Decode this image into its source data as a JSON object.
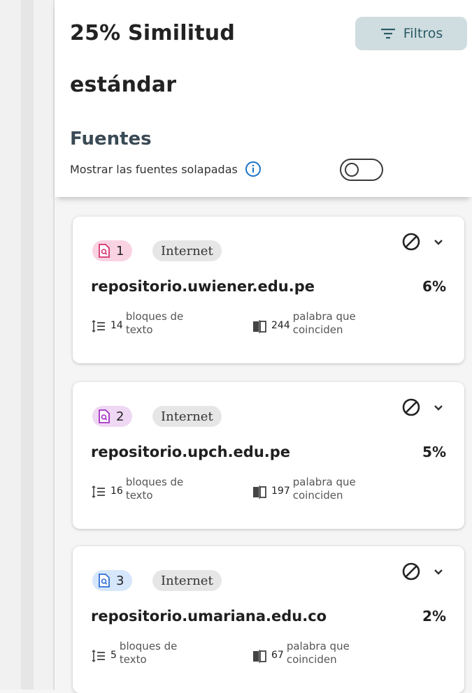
{
  "header": {
    "title_line1": "25% Similitud",
    "title_line2": "estándar",
    "filter_button_label": "Filtros",
    "sources_title": "Fuentes",
    "overlap_label": "Mostrar las fuentes solapadas"
  },
  "icons": {
    "filter": "filter-icon",
    "info": "info-icon",
    "toggle": "toggle-switch",
    "exclude": "ban-icon",
    "expand": "chevron-down-icon",
    "blocks": "text-blocks-icon",
    "words": "matching-words-icon",
    "source_doc": "document-search-icon"
  },
  "colors": {
    "filter_bg": "#cfdde0",
    "filter_text": "#2b5a66"
  },
  "sources": [
    {
      "rank": "1",
      "type": "Internet",
      "name": "repositorio.uwiener.edu.pe",
      "percent": "6%",
      "blocks_count": "14",
      "blocks_label_1": "bloques de",
      "blocks_label_2": "texto",
      "words_count": "244",
      "words_label_1": "palabra que",
      "words_label_2": "coinciden",
      "badge_color": "#f9d3e2",
      "icon_color": "#d6336c"
    },
    {
      "rank": "2",
      "type": "Internet",
      "name": "repositorio.upch.edu.pe",
      "percent": "5%",
      "blocks_count": "16",
      "blocks_label_1": "bloques de",
      "blocks_label_2": "texto",
      "words_count": "197",
      "words_label_1": "palabra que",
      "words_label_2": "coinciden",
      "badge_color": "#efd8f4",
      "icon_color": "#a230c2"
    },
    {
      "rank": "3",
      "type": "Internet",
      "name": "repositorio.umariana.edu.co",
      "percent": "2%",
      "blocks_count": "5",
      "blocks_label_1": "bloques de",
      "blocks_label_2": "texto",
      "words_count": "67",
      "words_label_1": "palabra que",
      "words_label_2": "coinciden",
      "badge_color": "#d6e6fb",
      "icon_color": "#2f6fd6"
    }
  ]
}
